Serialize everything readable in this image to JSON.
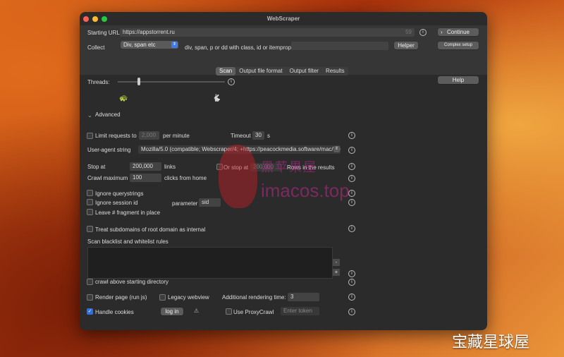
{
  "window": {
    "title": "WebScraper"
  },
  "top": {
    "starting_url_label": "Starting URL",
    "starting_url_value": "https://appstorrent.ru",
    "url_count": "59",
    "continue_label": "Continue",
    "collect_label": "Collect",
    "collect_select": "Div, span etc",
    "collect_desc": "div, span, p or dd with class, id or itemprop:",
    "helper_label": "Helper",
    "complex_setup_label": "Complex setup"
  },
  "tabs": [
    {
      "label": "Scan",
      "active": true
    },
    {
      "label": "Output file format",
      "active": false
    },
    {
      "label": "Output filter",
      "active": false
    },
    {
      "label": "Results",
      "active": false
    }
  ],
  "scan": {
    "threads_label": "Threads:",
    "threads_level": 0.19,
    "help_label": "Help",
    "advanced_label": "Advanced",
    "limit_requests_label": "Limit requests to",
    "limit_requests_value": "2,000",
    "per_minute_label": "per minute",
    "timeout_label": "Timeout",
    "timeout_value": "30",
    "timeout_unit": "s",
    "user_agent_label": "User-agent string",
    "user_agent_value": "Mozilla/5.0 (compatible; Webscraper/4; +https://peacockmedia.software/mac/we",
    "stop_at_label": "Stop at",
    "stop_at_value": "200,000",
    "links_label": "links",
    "or_stop_at_label": "Or stop at",
    "or_stop_at_value": "200,000",
    "rows_label": "Rows in the results",
    "crawl_max_label": "Crawl maximum",
    "crawl_max_value": "100",
    "clicks_label": "clicks from home",
    "ignore_qs_label": "Ignore querystrings",
    "ignore_session_label": "Ignore session id",
    "parameter_label": "parameter",
    "parameter_value": "sid",
    "leave_fragment_label": "Leave # fragment in place",
    "treat_subdomains_label": "Treat subdomains of root domain as internal",
    "blacklist_label": "Scan blacklist and whitelist rules",
    "minus_label": "-",
    "plus_label": "+",
    "crawl_above_label": "crawl above starting directory",
    "render_label": "Render page (run js)",
    "legacy_label": "Legacy webview",
    "additional_label": "Additional rendering time:",
    "additional_value": "3",
    "handle_cookies_label": "Handle cookies",
    "login_label": "log in",
    "proxycrawl_label": "Use ProxyCrawl",
    "enter_token_placeholder": "Enter token"
  },
  "watermarks": {
    "text1": "黑苹果屋",
    "text2": "imacos.top",
    "text3": "宝藏星球屋"
  },
  "colors": {
    "accent": "#2f6fe4",
    "window_bg": "#2b2b2b"
  }
}
